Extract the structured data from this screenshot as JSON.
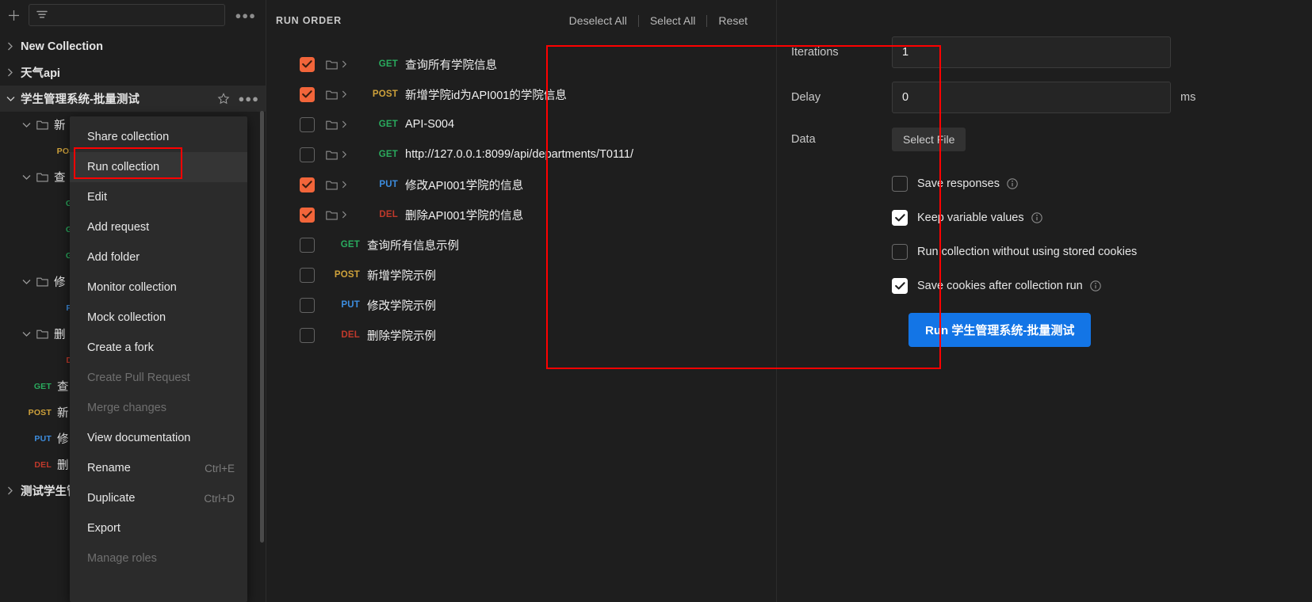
{
  "sidebar": {
    "toolbar": {
      "new_label": "+",
      "search_placeholder": "",
      "more_label": "●●●"
    },
    "items": [
      {
        "label": "New Collection",
        "type": "collection",
        "expanded": false,
        "method": ""
      },
      {
        "label": "天气api",
        "type": "collection",
        "expanded": false,
        "method": ""
      },
      {
        "label": "学生管理系统-批量测试",
        "type": "collection",
        "expanded": true,
        "method": ""
      },
      {
        "label": "新",
        "type": "folder",
        "expanded": true,
        "method": ""
      },
      {
        "label": "",
        "type": "request",
        "method": "POST"
      },
      {
        "label": "查",
        "type": "folder",
        "expanded": true,
        "method": ""
      },
      {
        "label": "",
        "type": "request",
        "method": "GET"
      },
      {
        "label": "",
        "type": "request",
        "method": "GET"
      },
      {
        "label": "",
        "type": "request",
        "method": "GET"
      },
      {
        "label": "修",
        "type": "folder",
        "expanded": true,
        "method": ""
      },
      {
        "label": "",
        "type": "request",
        "method": "PUT"
      },
      {
        "label": "删",
        "type": "folder",
        "expanded": true,
        "method": ""
      },
      {
        "label": "",
        "type": "request",
        "method": "DEL"
      },
      {
        "label": "查",
        "type": "request",
        "method": "GET"
      },
      {
        "label": "新",
        "type": "request",
        "method": "POST"
      },
      {
        "label": "修",
        "type": "request",
        "method": "PUT"
      },
      {
        "label": "删",
        "type": "request",
        "method": "DEL"
      },
      {
        "label": "测试学生管",
        "type": "collection",
        "expanded": false,
        "method": ""
      }
    ]
  },
  "context_menu": {
    "items": [
      {
        "label": "Share collection",
        "shortcut": "",
        "disabled": false,
        "highlighted": false
      },
      {
        "label": "Run collection",
        "shortcut": "",
        "disabled": false,
        "highlighted": true
      },
      {
        "label": "Edit",
        "shortcut": "",
        "disabled": false,
        "highlighted": false
      },
      {
        "label": "Add request",
        "shortcut": "",
        "disabled": false,
        "highlighted": false
      },
      {
        "label": "Add folder",
        "shortcut": "",
        "disabled": false,
        "highlighted": false
      },
      {
        "label": "Monitor collection",
        "shortcut": "",
        "disabled": false,
        "highlighted": false
      },
      {
        "label": "Mock collection",
        "shortcut": "",
        "disabled": false,
        "highlighted": false
      },
      {
        "label": "Create a fork",
        "shortcut": "",
        "disabled": false,
        "highlighted": false
      },
      {
        "label": "Create Pull Request",
        "shortcut": "",
        "disabled": true,
        "highlighted": false
      },
      {
        "label": "Merge changes",
        "shortcut": "",
        "disabled": true,
        "highlighted": false
      },
      {
        "label": "View documentation",
        "shortcut": "",
        "disabled": false,
        "highlighted": false
      },
      {
        "label": "Rename",
        "shortcut": "Ctrl+E",
        "disabled": false,
        "highlighted": false
      },
      {
        "label": "Duplicate",
        "shortcut": "Ctrl+D",
        "disabled": false,
        "highlighted": false
      },
      {
        "label": "Export",
        "shortcut": "",
        "disabled": false,
        "highlighted": false
      },
      {
        "label": "Manage roles",
        "shortcut": "",
        "disabled": true,
        "highlighted": false
      }
    ]
  },
  "run_order": {
    "title": "RUN ORDER",
    "deselect_all": "Deselect All",
    "select_all": "Select All",
    "reset": "Reset",
    "rows": [
      {
        "checked": true,
        "in_folder": true,
        "method": "GET",
        "name": "查询所有学院信息"
      },
      {
        "checked": true,
        "in_folder": true,
        "method": "POST",
        "name": "新增学院id为API001的学院信息"
      },
      {
        "checked": false,
        "in_folder": true,
        "method": "GET",
        "name": "API-S004"
      },
      {
        "checked": false,
        "in_folder": true,
        "method": "GET",
        "name": "http://127.0.0.1:8099/api/departments/T0111/"
      },
      {
        "checked": true,
        "in_folder": true,
        "method": "PUT",
        "name": "修改API001学院的信息"
      },
      {
        "checked": true,
        "in_folder": true,
        "method": "DEL",
        "name": "删除API001学院的信息"
      },
      {
        "checked": false,
        "in_folder": false,
        "method": "GET",
        "name": "查询所有信息示例"
      },
      {
        "checked": false,
        "in_folder": false,
        "method": "POST",
        "name": "新增学院示例"
      },
      {
        "checked": false,
        "in_folder": false,
        "method": "PUT",
        "name": "修改学院示例"
      },
      {
        "checked": false,
        "in_folder": false,
        "method": "DEL",
        "name": "删除学院示例"
      }
    ]
  },
  "config": {
    "iterations_label": "Iterations",
    "iterations_value": "1",
    "delay_label": "Delay",
    "delay_value": "0",
    "delay_unit": "ms",
    "data_label": "Data",
    "select_file_label": "Select File",
    "options": [
      {
        "label": "Save responses",
        "checked": false,
        "info": true
      },
      {
        "label": "Keep variable values",
        "checked": true,
        "info": true
      },
      {
        "label": "Run collection without using stored cookies",
        "checked": false,
        "info": false
      },
      {
        "label": "Save cookies after collection run",
        "checked": true,
        "info": true
      }
    ],
    "run_button_label": "Run 学生管理系统-批量测试"
  },
  "colors": {
    "accent_blue": "#1375e6",
    "checkbox_orange": "#f2653a",
    "highlight_red": "#ff0000",
    "get_green": "#2aab5e",
    "post_yellow": "#cfa23b",
    "put_blue": "#3d8ee0",
    "del_red": "#c0392b"
  }
}
